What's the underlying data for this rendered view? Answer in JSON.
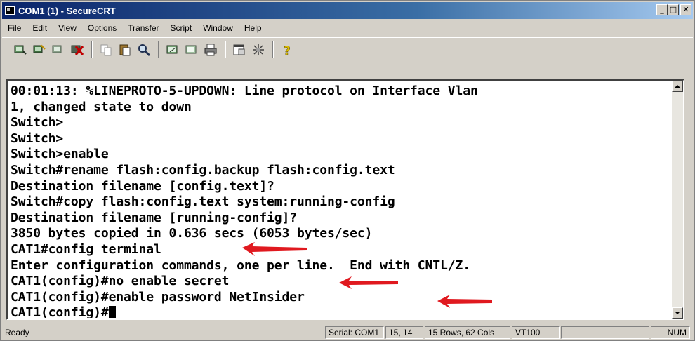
{
  "window": {
    "title": "COM1 (1) - SecureCRT",
    "buttons": {
      "minimize": "_",
      "maximize": "□",
      "close": "✕"
    }
  },
  "menu": [
    {
      "label": "File",
      "ul": "F"
    },
    {
      "label": "Edit",
      "ul": "E"
    },
    {
      "label": "View",
      "ul": "V"
    },
    {
      "label": "Options",
      "ul": "O"
    },
    {
      "label": "Transfer",
      "ul": "T"
    },
    {
      "label": "Script",
      "ul": "S"
    },
    {
      "label": "Window",
      "ul": "W"
    },
    {
      "label": "Help",
      "ul": "H"
    }
  ],
  "toolbar": {
    "icons": [
      "connect-icon",
      "quick-connect-icon",
      "reconnect-icon",
      "disconnect-icon",
      "copy-icon",
      "paste-icon",
      "find-icon",
      "print-setup-icon",
      "print-selection-icon",
      "print-icon",
      "session-options-icon",
      "keymap-icon",
      "help-icon"
    ]
  },
  "terminal": {
    "lines": [
      "00:01:13: %LINEPROTO-5-UPDOWN: Line protocol on Interface Vlan",
      "1, changed state to down",
      "Switch>",
      "Switch>",
      "Switch>enable",
      "Switch#rename flash:config.backup flash:config.text",
      "Destination filename [config.text]?",
      "Switch#copy flash:config.text system:running-config",
      "Destination filename [running-config]?",
      "3850 bytes copied in 0.636 secs (6053 bytes/sec)",
      "CAT1#config terminal",
      "Enter configuration commands, one per line.  End with CNTL/Z.",
      "CAT1(config)#no enable secret",
      "CAT1(config)#enable password NetInsider",
      "CAT1(config)#"
    ],
    "arrow_color": "#e0191f"
  },
  "status": {
    "ready": "Ready",
    "serial": "Serial: COM1",
    "position": "15, 14",
    "size": "15 Rows, 62 Cols",
    "emulation": "VT100",
    "empty": "",
    "num": "NUM"
  }
}
